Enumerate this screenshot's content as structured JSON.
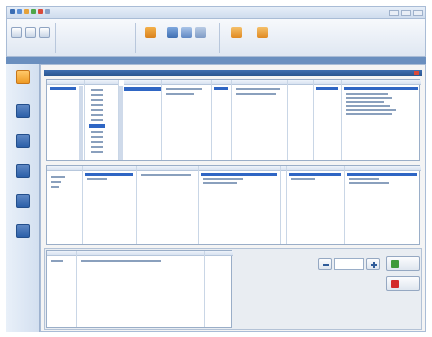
{
  "colors": {
    "accent_blue": "#2f66c4",
    "header_blue": "#2a568f",
    "sidebar_bg": "#dce6f3",
    "delete_red": "#d32b2b",
    "confirm_green": "#3f9a3a",
    "toolbar_orange": "#e88c1e"
  },
  "window": {
    "title": ""
  },
  "ribbon": {
    "tabs": [
      "",
      "",
      ""
    ],
    "buttons": [
      "",
      "",
      "",
      "",
      "",
      "",
      "",
      "",
      ""
    ]
  },
  "sidebar": {
    "items": [
      {
        "label": "",
        "icon": "calendar-icon"
      },
      {
        "label": "",
        "icon": "grid-icon"
      },
      {
        "label": "",
        "icon": "settings-icon"
      },
      {
        "label": "",
        "icon": "monitor-icon"
      },
      {
        "label": "",
        "icon": "save-icon"
      },
      {
        "label": "",
        "icon": "printer-icon"
      }
    ]
  },
  "panel": {
    "title": ""
  },
  "upper_table": {
    "headers": [
      "",
      "",
      "",
      "",
      "",
      "",
      "",
      "",
      ""
    ]
  },
  "middle_table": {
    "headers": [
      "",
      "",
      "",
      "",
      "",
      "",
      ""
    ]
  },
  "bottom_table": {
    "headers": [
      "",
      "",
      ""
    ]
  },
  "stepper": {
    "value": ""
  },
  "actions": {
    "confirm_label": "",
    "delete_label": ""
  }
}
